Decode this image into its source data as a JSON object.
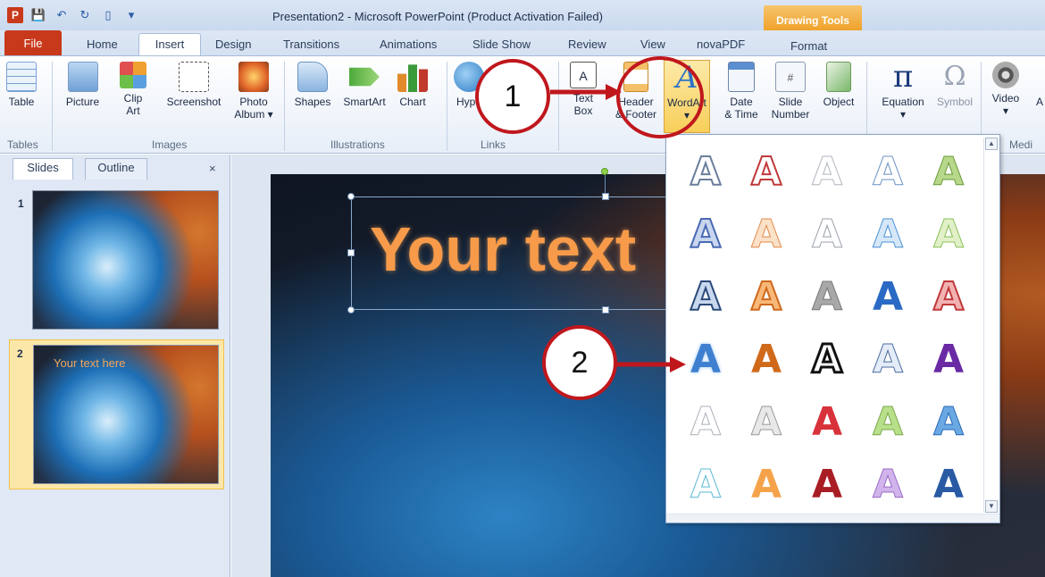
{
  "titlebar": {
    "title": "Presentation2 - Microsoft PowerPoint (Product Activation Failed)",
    "context_group": "Drawing Tools"
  },
  "tabs": {
    "file": "File",
    "home": "Home",
    "insert": "Insert",
    "design": "Design",
    "transitions": "Transitions",
    "animations": "Animations",
    "slideshow": "Slide Show",
    "review": "Review",
    "view": "View",
    "novapdf": "novaPDF",
    "format": "Format"
  },
  "ribbon": {
    "table": "Table",
    "picture": "Picture",
    "clipart": "Clip\nArt",
    "screenshot": "Screenshot",
    "photoalbum": "Photo\nAlbum ▾",
    "shapes": "Shapes",
    "smartart": "SmartArt",
    "chart": "Chart",
    "hyperlink": "Hype",
    "textbox": "Text\nBox",
    "headerfooter": "Header\n& Footer",
    "wordart": "WordArt",
    "datetime": "Date\n& Time",
    "slidenumber": "Slide\nNumber",
    "object": "Object",
    "equation": "Equation",
    "symbol": "Symbol",
    "video": "Video",
    "audio": "A",
    "groups": {
      "tables": "Tables",
      "images": "Images",
      "illustrations": "Illustrations",
      "links": "Links",
      "media": "Medi"
    }
  },
  "panel": {
    "slides_tab": "Slides",
    "outline_tab": "Outline",
    "close": "×",
    "slide1_num": "1",
    "slide2_num": "2",
    "slide2_text": "Your  text here"
  },
  "slide": {
    "title_text": "Your text"
  },
  "callouts": {
    "one": "1",
    "two": "2"
  },
  "colors": {
    "accent_red": "#c0171d",
    "file_tab": "#c8391b",
    "drawing_tools": "#f0a22b"
  }
}
